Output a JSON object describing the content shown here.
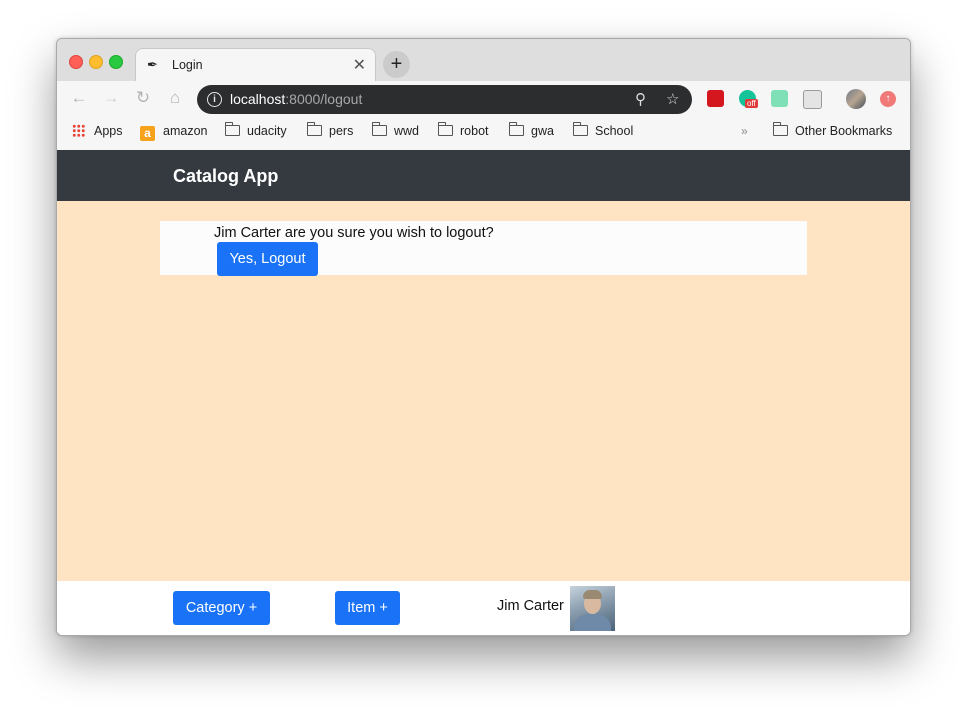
{
  "browser": {
    "tab": {
      "title": "Login"
    },
    "url": {
      "host": "localhost",
      "path": ":8000/logout"
    },
    "bookmarks": [
      {
        "label": "Apps",
        "icon": "apps-grid-icon"
      },
      {
        "label": "amazon",
        "icon": "amazon-icon"
      },
      {
        "label": "udacity",
        "icon": "folder-icon"
      },
      {
        "label": "pers",
        "icon": "folder-icon"
      },
      {
        "label": "wwd",
        "icon": "folder-icon"
      },
      {
        "label": "robot",
        "icon": "folder-icon"
      },
      {
        "label": "gwa",
        "icon": "folder-icon"
      },
      {
        "label": "School",
        "icon": "folder-icon"
      }
    ],
    "bookmarks_more": "»",
    "other_bookmarks": "Other Bookmarks",
    "extensions": {
      "grammarly_badge": "off"
    }
  },
  "app": {
    "brand": "Catalog App",
    "logout": {
      "question": "Jim Carter are you sure you wish to logout?",
      "confirm_label": "Yes, Logout"
    },
    "footer": {
      "category_button": "Category +",
      "item_button": "Item +",
      "user_name": "Jim Carter"
    }
  },
  "colors": {
    "navbar": "#343a40",
    "content_bg": "#ffe4c4",
    "primary_button": "#1a73f6"
  }
}
